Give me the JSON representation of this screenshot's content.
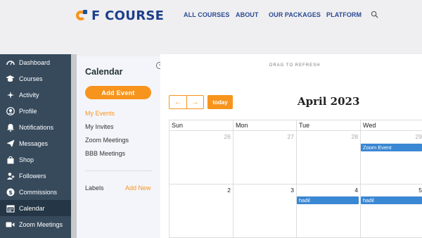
{
  "header": {
    "logo_text": "F COURSE",
    "nav": [
      "ALL COURSES",
      "ABOUT",
      "OUR PACKAGES",
      "PLATFORM"
    ],
    "search_icon": "search-icon"
  },
  "sidebar": {
    "items": [
      {
        "label": "Dashboard",
        "icon": "dashboard-icon"
      },
      {
        "label": "Courses",
        "icon": "courses-icon"
      },
      {
        "label": "Activity",
        "icon": "activity-icon"
      },
      {
        "label": "Profile",
        "icon": "profile-icon"
      },
      {
        "label": "Notifications",
        "icon": "bell-icon"
      },
      {
        "label": "Messages",
        "icon": "paper-plane-icon"
      },
      {
        "label": "Shop",
        "icon": "shop-bag-icon"
      },
      {
        "label": "Followers",
        "icon": "followers-icon"
      },
      {
        "label": "Commissions",
        "icon": "dollar-icon"
      },
      {
        "label": "Calendar",
        "icon": "calendar-icon",
        "active": true
      },
      {
        "label": "Zoom Meetings",
        "icon": "video-icon"
      }
    ]
  },
  "panel": {
    "title": "Calendar",
    "add_event": "Add Event",
    "links": [
      "My Events",
      "My Invites",
      "Zoom Meetings",
      "BBB Meetings"
    ],
    "labels": "Labels",
    "add_new": "Add New"
  },
  "calendar": {
    "drag_hint": "DRAG TO REFRESH",
    "today": "today",
    "month": "April 2023",
    "days": [
      "Sun",
      "Mon",
      "Tue",
      "Wed"
    ],
    "week1": [
      "26",
      "27",
      "28",
      "29"
    ],
    "week2": [
      "2",
      "3",
      "4",
      "5"
    ],
    "events": {
      "zoom": "Zoom Event",
      "hadil_tue": "hadil",
      "hadil_wed": "hadil"
    }
  },
  "colors": {
    "accent": "#f7941d",
    "sidebar": "#374a5c",
    "event": "#3a87d4",
    "brand": "#1d3f8a"
  }
}
